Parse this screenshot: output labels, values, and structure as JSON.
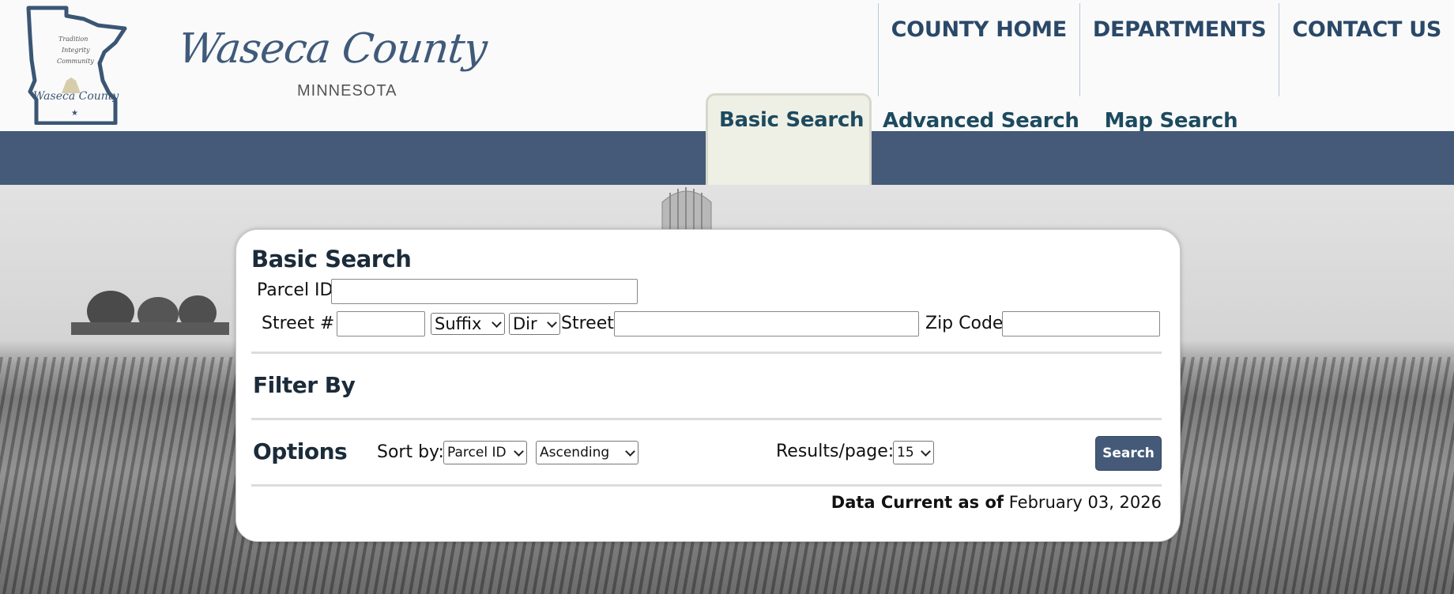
{
  "header": {
    "brand_name": "Waseca County",
    "brand_state": "MINNESOTA",
    "state_logo_text": "Waseca County",
    "state_logo_motto": "Tradition Integrity Community"
  },
  "topnav": {
    "items": [
      "COUNTY HOME",
      "DEPARTMENTS",
      "CONTACT US"
    ]
  },
  "tabs": {
    "basic": "Basic Search",
    "advanced": "Advanced Search",
    "map": "Map Search",
    "active": "Basic Search"
  },
  "search": {
    "title": "Basic Search",
    "parcel_label": "Parcel ID",
    "parcel_value": "",
    "streetnum_label": "Street #",
    "streetnum_value": "",
    "suffix_selected": "Suffix",
    "dir_selected": "Dir",
    "street_label": "Street",
    "street_value": "",
    "zip_label": "Zip Code",
    "zip_value": ""
  },
  "filter": {
    "title": "Filter By"
  },
  "options": {
    "title": "Options",
    "sort_label": "Sort by:",
    "sort_selected": "Parcel ID",
    "order_selected": "Ascending",
    "results_label": "Results/page:",
    "results_selected": "15",
    "search_button": "Search"
  },
  "footer": {
    "data_current_label": "Data Current as of",
    "data_current_date": "February 03, 2026"
  },
  "colors": {
    "nav_text": "#2a4868",
    "tab_text": "#1d4a5e",
    "bar": "#445a78",
    "button": "#445a78",
    "active_tab_bg": "#eef0e6"
  },
  "icons": [
    "minnesota-state-logo-icon",
    "chevron-down-icon"
  ]
}
